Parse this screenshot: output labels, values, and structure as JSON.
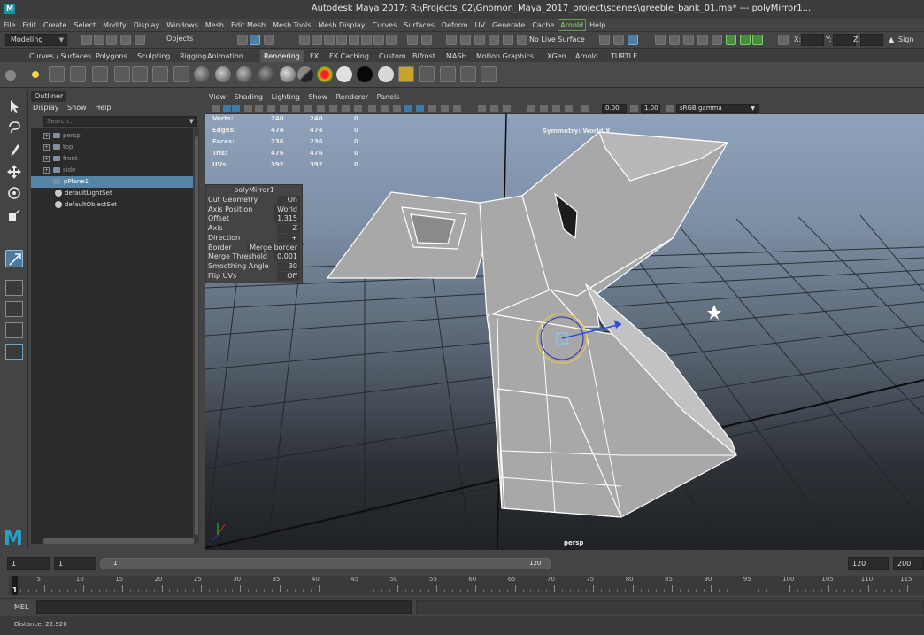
{
  "window": {
    "title": "Autodesk Maya 2017: R:\\Projects_02\\Gnomon_Maya_2017_project\\scenes\\greeble_bank_01.ma*   ---   polyMirror1..."
  },
  "menubar": {
    "items": [
      "File",
      "Edit",
      "Create",
      "Select",
      "Modify",
      "Display",
      "Windows",
      "Mesh",
      "Edit Mesh",
      "Mesh Tools",
      "Mesh Display",
      "Curves",
      "Surfaces",
      "Deform",
      "UV",
      "Generate",
      "Cache",
      "Arnold",
      "Help"
    ]
  },
  "statusline": {
    "mode": "Modeling",
    "select_mode": "Objects",
    "live_surface": "No Live Surface",
    "x_label": "X:",
    "y_label": "Y:",
    "z_label": "Z:",
    "sign_in": "Sign"
  },
  "shelf": {
    "tabs": [
      "Curves / Surfaces",
      "Polygons",
      "Sculpting",
      "Rigging",
      "Animation",
      "Rendering",
      "FX",
      "FX Caching",
      "Custom",
      "Bifrost",
      "MASH",
      "Motion Graphics",
      "XGen",
      "Arnold",
      "TURTLE"
    ],
    "active_tab": "Rendering"
  },
  "outliner": {
    "title": "Outliner",
    "menu": [
      "Display",
      "Show",
      "Help"
    ],
    "search_placeholder": "Search...",
    "items": [
      {
        "label": "persp",
        "type": "camera"
      },
      {
        "label": "top",
        "type": "camera"
      },
      {
        "label": "front",
        "type": "camera"
      },
      {
        "label": "side",
        "type": "camera"
      },
      {
        "label": "pPlane1",
        "type": "mesh",
        "selected": true
      },
      {
        "label": "defaultLightSet",
        "type": "set"
      },
      {
        "label": "defaultObjectSet",
        "type": "set"
      }
    ]
  },
  "viewport": {
    "menu": [
      "View",
      "Shading",
      "Lighting",
      "Show",
      "Renderer",
      "Panels"
    ],
    "field1": "0.00",
    "field2": "1.00",
    "color_space": "sRGB gamma",
    "camera": "persp",
    "symmetry": "Symmetry: World X",
    "hud": [
      {
        "label": "Verts:",
        "a": "240",
        "b": "240",
        "c": "0"
      },
      {
        "label": "Edges:",
        "a": "474",
        "b": "474",
        "c": "0"
      },
      {
        "label": "Faces:",
        "a": "236",
        "b": "236",
        "c": "0"
      },
      {
        "label": "Tris:",
        "a": "476",
        "b": "476",
        "c": "0"
      },
      {
        "label": "UVs:",
        "a": "392",
        "b": "392",
        "c": "0"
      }
    ]
  },
  "polymirror": {
    "title": "polyMirror1",
    "attributes": [
      {
        "label": "Cut Geometry",
        "value": "On"
      },
      {
        "label": "Axis Position",
        "value": "World"
      },
      {
        "label": "Offset",
        "value": "1.315"
      },
      {
        "label": "Axis",
        "value": "Z"
      },
      {
        "label": "Direction",
        "value": "+"
      },
      {
        "label": "Border",
        "value": "Merge border"
      },
      {
        "label": "Merge Threshold",
        "value": "0.001"
      },
      {
        "label": "Smoothing Angle",
        "value": "30"
      },
      {
        "label": "Flip UVs",
        "value": "Off"
      }
    ]
  },
  "range": {
    "start": "1",
    "playback_start": "1",
    "slider_start": "1",
    "slider_end": "120",
    "playback_end": "120",
    "end": "200"
  },
  "timeline": {
    "current_frame": "1",
    "ticks": [
      "5",
      "10",
      "15",
      "20",
      "25",
      "30",
      "35",
      "40",
      "45",
      "50",
      "55",
      "60",
      "65",
      "70",
      "75",
      "80",
      "85",
      "90",
      "95",
      "100",
      "105",
      "110",
      "115"
    ]
  },
  "cmdline": {
    "label": "MEL"
  },
  "helpline": {
    "text": "Distance:      22.920"
  }
}
